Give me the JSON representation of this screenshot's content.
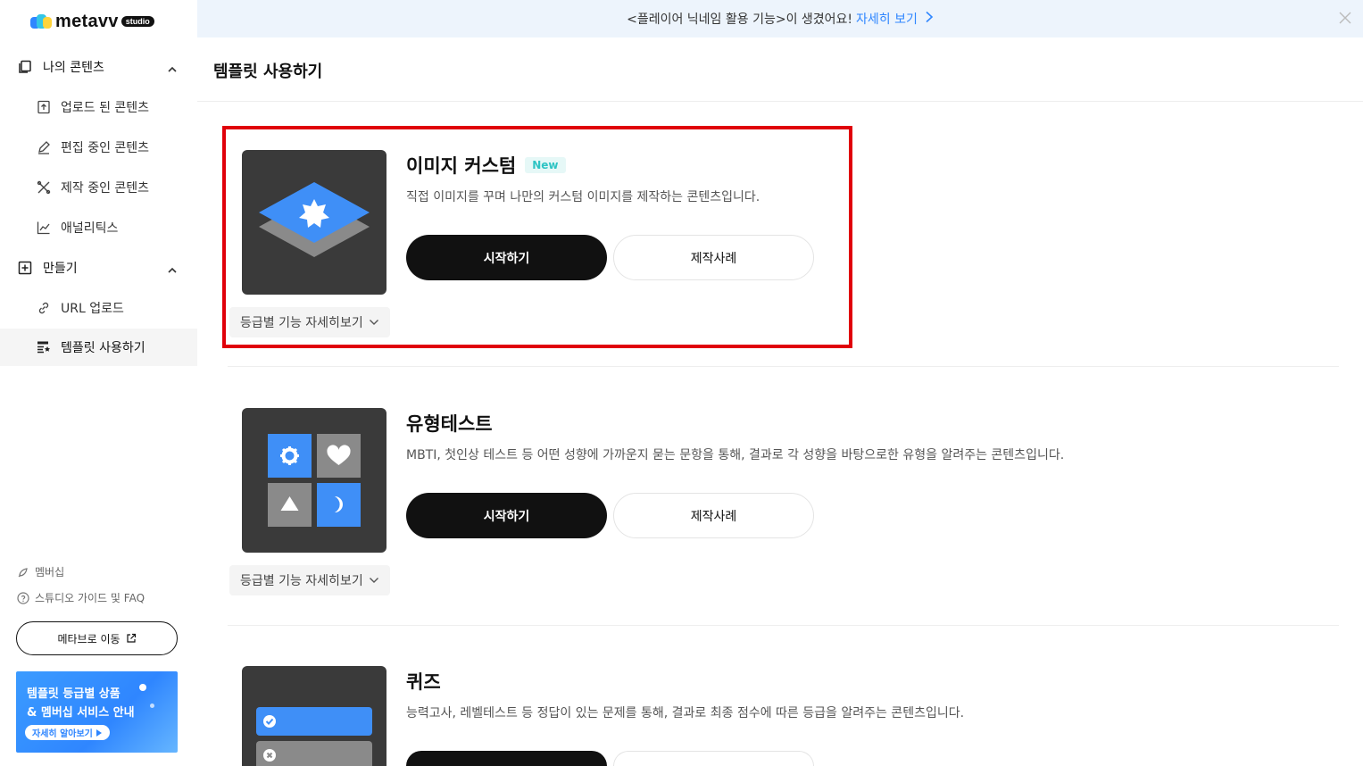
{
  "logo": {
    "text": "metavv",
    "badge": "studio"
  },
  "banner": {
    "text": "<플레이어 닉네임 활용 기능>이 생겼어요!",
    "link": "자세히 보기"
  },
  "sidebar": {
    "groups": [
      {
        "label": "나의 콘텐츠",
        "items": [
          {
            "label": "업로드 된 콘텐츠",
            "icon": "upload-icon"
          },
          {
            "label": "편집 중인 콘텐츠",
            "icon": "pencil-icon"
          },
          {
            "label": "제작 중인 콘텐츠",
            "icon": "tools-icon"
          },
          {
            "label": "애널리틱스",
            "icon": "chart-icon"
          }
        ]
      },
      {
        "label": "만들기",
        "items": [
          {
            "label": "URL 업로드",
            "icon": "link-icon"
          },
          {
            "label": "템플릿 사용하기",
            "icon": "template-icon",
            "active": true
          }
        ]
      }
    ],
    "membership": "멤버십",
    "guide": "스튜디오 가이드 및 FAQ",
    "metaverse_button": "메타브로 이동",
    "promo": {
      "line1": "템플릿 등급별 상품",
      "line2": "& 멤버십 서비스 안내",
      "button": "자세히 알아보기"
    }
  },
  "page": {
    "title": "템플릿 사용하기"
  },
  "templates": [
    {
      "title": "이미지 커스텀",
      "badge": "New",
      "description": "직접 이미지를 꾸며 나만의 커스텀 이미지를 제작하는 콘텐츠입니다.",
      "start": "시작하기",
      "example": "제작사례",
      "tier": "등급별 기능 자세히보기"
    },
    {
      "title": "유형테스트",
      "description": "MBTI, 첫인상 테스트 등 어떤 성향에 가까운지 묻는 문항을 통해, 결과로 각 성향을 바탕으로한 유형을 알려주는 콘텐츠입니다.",
      "start": "시작하기",
      "example": "제작사례",
      "tier": "등급별 기능 자세히보기"
    },
    {
      "title": "퀴즈",
      "description": "능력고사, 레벨테스트 등 정답이 있는 문제를 통해, 결과로 최종 점수에 따른 등급을 알려주는 콘텐츠입니다."
    }
  ],
  "colors": {
    "accent": "#2f86ff",
    "highlight": "#e0000a",
    "new_badge": "#2ec4c4"
  }
}
